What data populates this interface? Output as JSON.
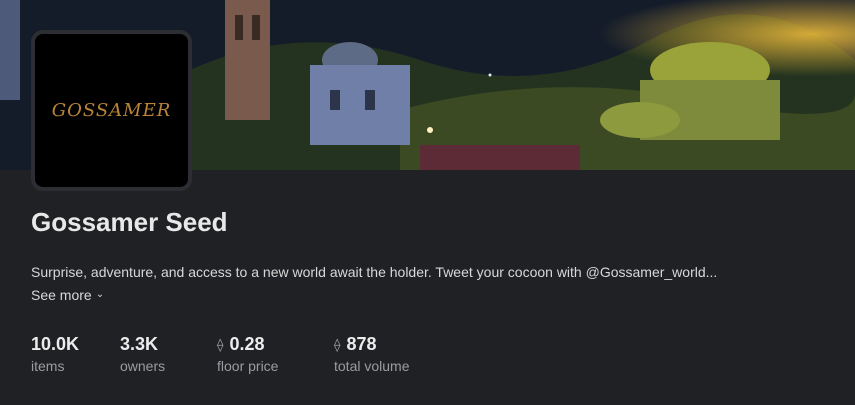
{
  "collection": {
    "name": "Gossamer Seed",
    "avatar_text": "GOSSAMER",
    "description": "Surprise, adventure, and access to a new world await the holder. Tweet your cocoon with @Gossamer_world...",
    "see_more_label": "See more",
    "stats": [
      {
        "value": "10.0K",
        "label": "items",
        "currency_icon": ""
      },
      {
        "value": "3.3K",
        "label": "owners",
        "currency_icon": ""
      },
      {
        "value": "0.28",
        "label": "floor price",
        "currency_icon": "eth-icon"
      },
      {
        "value": "878",
        "label": "total volume",
        "currency_icon": "eth-icon"
      }
    ]
  },
  "colors": {
    "background": "#1f2124",
    "avatar_border": "#2c2e33",
    "logo_gold": "#b9843a"
  }
}
